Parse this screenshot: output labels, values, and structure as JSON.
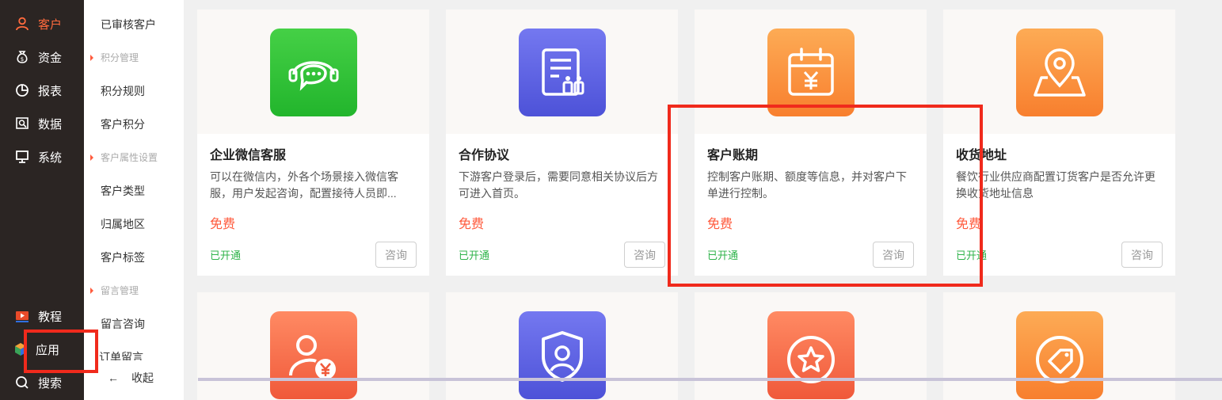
{
  "nav": {
    "items": [
      {
        "label": "客户",
        "icon": "user-icon",
        "active": true
      },
      {
        "label": "资金",
        "icon": "money-bag-icon",
        "active": false
      },
      {
        "label": "报表",
        "icon": "pie-chart-icon",
        "active": false
      },
      {
        "label": "数据",
        "icon": "data-search-icon",
        "active": false
      },
      {
        "label": "系统",
        "icon": "monitor-icon",
        "active": false
      }
    ],
    "bottom": [
      {
        "label": "教程",
        "icon": "video-play-icon"
      },
      {
        "label": "应用",
        "icon": "cube-icon"
      },
      {
        "label": "搜索",
        "icon": "search-icon"
      }
    ],
    "accent_color": "#ff6a3d"
  },
  "submenu": {
    "items": [
      {
        "type": "item",
        "label": "已审核客户"
      },
      {
        "type": "group",
        "label": "积分管理"
      },
      {
        "type": "item",
        "label": "积分规则"
      },
      {
        "type": "item",
        "label": "客户积分"
      },
      {
        "type": "group",
        "label": "客户属性设置"
      },
      {
        "type": "item",
        "label": "客户类型"
      },
      {
        "type": "item",
        "label": "归属地区"
      },
      {
        "type": "item",
        "label": "客户标签"
      },
      {
        "type": "group",
        "label": "留言管理"
      },
      {
        "type": "item",
        "label": "留言咨询"
      },
      {
        "type": "item",
        "label": "订单留言"
      }
    ],
    "collapse_label": "收起"
  },
  "cards": [
    {
      "title": "企业微信客服",
      "desc": "可以在微信内，外各个场景接入微信客服，用户发起咨询，配置接待人员即...",
      "price": "免费",
      "status": "已开通",
      "button": "咨询",
      "icon": "chat-headset-icon",
      "color": "#35c43a"
    },
    {
      "title": "合作协议",
      "desc": "下游客户登录后，需要同意相关协议后方可进入首页。",
      "price": "免费",
      "status": "已开通",
      "button": "咨询",
      "icon": "agreement-document-icon",
      "color": "#5a5fe0"
    },
    {
      "title": "客户账期",
      "desc": "控制客户账期、额度等信息，并对客户下单进行控制。",
      "price": "免费",
      "status": "已开通",
      "button": "咨询",
      "icon": "calendar-yen-icon",
      "color": "#fb8d3a"
    },
    {
      "title": "收货地址",
      "desc": "餐饮行业供应商配置订货客户是否允许更换收货地址信息",
      "price": "免费",
      "status": "已开通",
      "button": "咨询",
      "icon": "map-pin-icon",
      "color": "#fb8d3a"
    }
  ],
  "cards_row2": [
    {
      "icon": "user-yen-icon",
      "color": "#f56b4a"
    },
    {
      "icon": "shield-user-icon",
      "color": "#5a5fe0"
    },
    {
      "icon": "star-badge-icon",
      "color": "#f56b4a"
    },
    {
      "icon": "tag-icon",
      "color": "#fb8d3a"
    }
  ]
}
